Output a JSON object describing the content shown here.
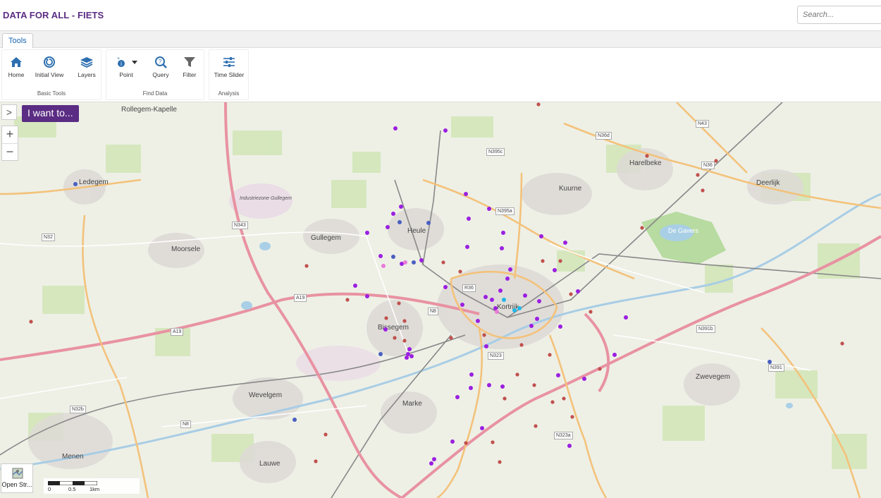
{
  "app": {
    "title": "DATA FOR ALL - FIETS"
  },
  "search": {
    "placeholder": "Search..."
  },
  "tabs": [
    {
      "label": "Tools"
    }
  ],
  "ribbon": {
    "groups": [
      {
        "label": "Basic Tools",
        "tools": [
          {
            "label": "Home",
            "icon": "home-icon"
          },
          {
            "label": "Initial View",
            "icon": "initial-view-icon"
          },
          {
            "label": "Layers",
            "icon": "layers-icon"
          }
        ]
      },
      {
        "label": "Find Data",
        "tools": [
          {
            "label": "Point",
            "icon": "point-info-icon"
          },
          {
            "label": "Query",
            "icon": "query-icon"
          },
          {
            "label": "Filter",
            "icon": "filter-icon"
          }
        ]
      },
      {
        "label": "Analysis",
        "tools": [
          {
            "label": "Time Slider",
            "icon": "time-slider-icon"
          }
        ]
      }
    ]
  },
  "map": {
    "expand_label": ">",
    "iwant_label": "I want to...",
    "zoom_in": "+",
    "zoom_out": "−",
    "basemap_label": "Open Str...",
    "scale": {
      "labels": [
        "0",
        "0.5",
        "1km"
      ]
    },
    "places": {
      "rollegem_kapelle": "Rollegem-Kapelle",
      "ledegem": "Ledegem",
      "moorsele": "Moorsele",
      "gullegem": "Gullegem",
      "heule": "Heule",
      "kuurne": "Kuurne",
      "harelbeke": "Harelbeke",
      "deerlijk": "Deerlijk",
      "kortrijk": "Kortrijk",
      "bissegem": "Bissegem",
      "wevelgem": "Wevelgem",
      "marke": "Marke",
      "zwevegem": "Zwevegem",
      "menen": "Menen",
      "lauwe": "Lauwe",
      "de_gavers": "De Gavers",
      "industriezone": "Industriezone Gullegem"
    },
    "roads": [
      "N32",
      "N343",
      "A19",
      "N8",
      "N36",
      "N36d",
      "N43",
      "N395c",
      "N395a",
      "R36",
      "N391b",
      "N391",
      "N323",
      "N323a",
      "N8",
      "N32b",
      "A19"
    ],
    "colors": {
      "red": "#c0504d",
      "purple": "#9b1fe0",
      "blue": "#4a5fc1",
      "cyan": "#1fb7e8",
      "pink": "#e97ad8",
      "motorway": "#e892a2",
      "primary": "#fcd6a4"
    }
  }
}
